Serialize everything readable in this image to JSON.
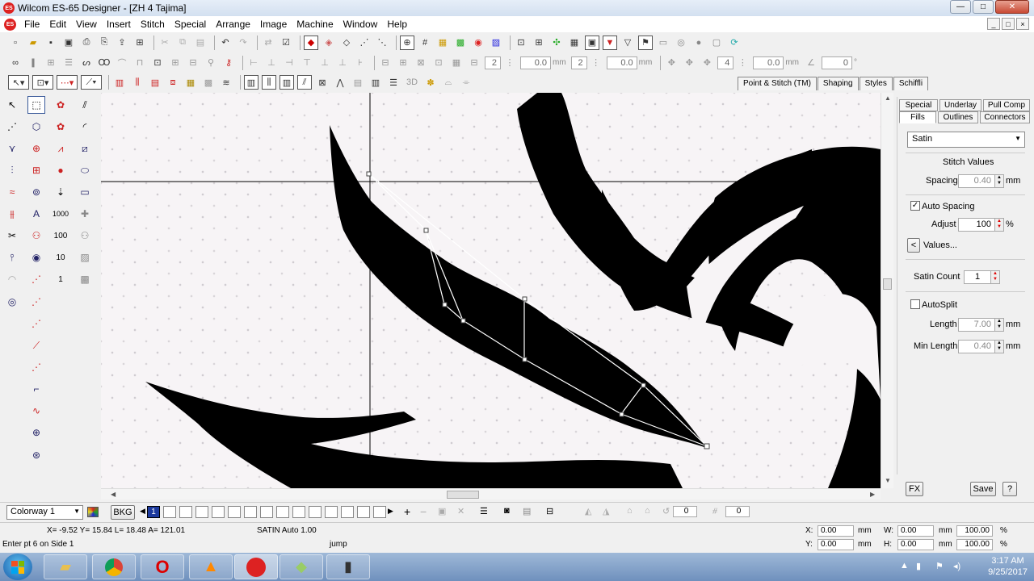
{
  "window": {
    "title": "Wilcom ES-65 Designer - [ZH 4          Tajima]",
    "logo": "ES",
    "btn_min": "—",
    "btn_max": "□",
    "btn_close": "✕"
  },
  "menu": {
    "logo": "ES",
    "items": [
      "File",
      "Edit",
      "View",
      "Insert",
      "Stitch",
      "Special",
      "Arrange",
      "Image",
      "Machine",
      "Window",
      "Help"
    ],
    "mdi_min": "_",
    "mdi_max": "□",
    "mdi_close": "×"
  },
  "toolbar2": {
    "values": [
      "2",
      "0.0",
      "2",
      "0.0",
      "4",
      "0.0",
      "0"
    ],
    "unit_mm": "mm",
    "unit_deg": "°"
  },
  "tabs_top": [
    "Point & Stitch (TM)",
    "Shaping",
    "Styles",
    "Schiffli"
  ],
  "panel": {
    "tabs_row1": [
      "Special",
      "Underlay",
      "Pull Comp"
    ],
    "tabs_row2": [
      "Fills",
      "Outlines",
      "Connectors"
    ],
    "fill_type": "Satin",
    "stitch_values_heading": "Stitch Values",
    "spacing_label": "Spacing",
    "spacing_value": "0.40",
    "unit_mm": "mm",
    "auto_spacing_label": "Auto Spacing",
    "auto_spacing_checked": "✓",
    "adjust_label": "Adjust",
    "adjust_value": "100",
    "unit_pct": "%",
    "values_button": "Values...",
    "values_arrow": "<",
    "satin_count_label": "Satin Count",
    "satin_count_value": "1",
    "autosplit_label": "AutoSplit",
    "length_label": "Length",
    "length_value": "7.00",
    "min_length_label": "Min Length",
    "min_length_value": "0.40",
    "fx_button": "FX",
    "save_button": "Save",
    "help_button": "?"
  },
  "colorbar": {
    "colorway": "Colorway 1",
    "bkg": "BKG",
    "active_swatch": "1",
    "spin_values": [
      "0",
      "0"
    ],
    "plus": "+",
    "minus": "−"
  },
  "status": {
    "coords": "X= -9.52 Y= 15.84 L= 18.48 A= 121.01",
    "object_info": "SATIN Auto  1.00",
    "prompt": "Enter pt 6 on Side 1",
    "function": "jump",
    "x_label": "X:",
    "x_value": "0.00",
    "y_label": "Y:",
    "y_value": "0.00",
    "w_label": "W:",
    "w_value": "0.00",
    "h_label": "H:",
    "h_value": "0.00",
    "unit_mm": "mm",
    "sx_value": "100.00",
    "sy_value": "100.00",
    "unit_pct": "%"
  },
  "taskbar": {
    "time": "3:17 AM",
    "date": "9/25/2017"
  },
  "colors": {
    "brand_red": "#d22222",
    "active_swatch": "#1c3a9e",
    "design_fill": "#000000",
    "canvas_bg": "#f7f4f6"
  },
  "icons": {
    "tb1": [
      "new-icon",
      "open-icon",
      "save-icon",
      "save-as-icon",
      "print-icon",
      "print-preview-icon",
      "export-icon",
      "cut-icon",
      "copy-icon",
      "paste-icon",
      "undo-icon",
      "redo-icon",
      "check-icon",
      "fill-icon",
      "grid-icon",
      "zoom-icon"
    ],
    "toolbox": [
      "select-icon",
      "reshape-icon",
      "flower-icon",
      "lines-icon",
      "knife-icon",
      "circle-icon",
      "ellipse-icon",
      "rectangle-icon",
      "lettering-icon",
      "monogram-icon"
    ]
  }
}
